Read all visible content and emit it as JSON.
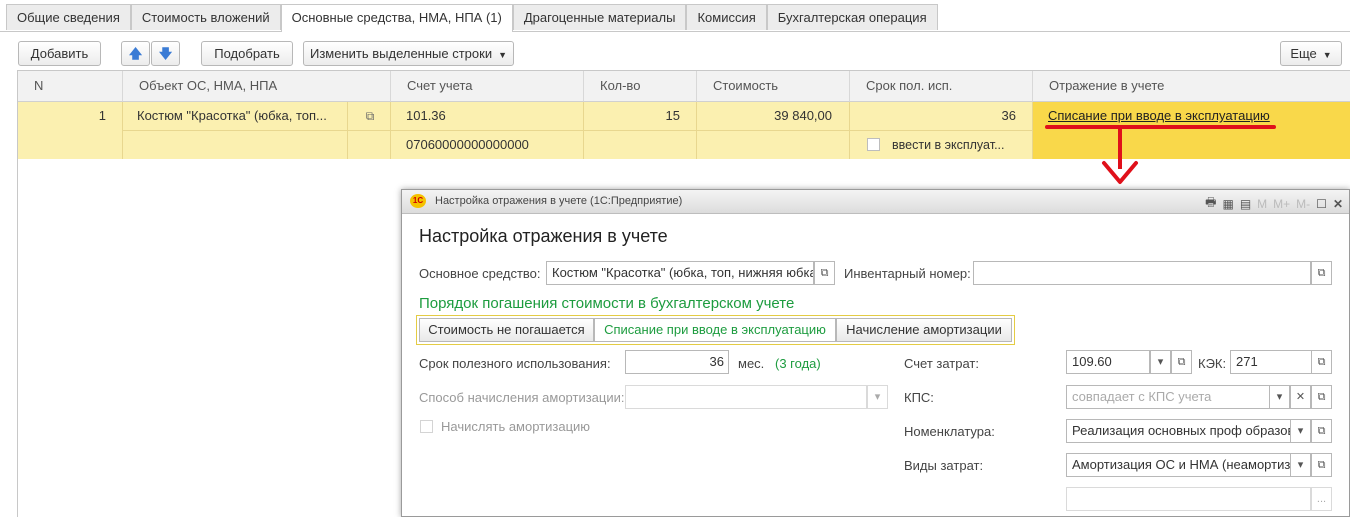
{
  "tabs": [
    "Общие сведения",
    "Стоимость вложений",
    "Основные средства, НМА, НПА (1)",
    "Драгоценные материалы",
    "Комиссия",
    "Бухгалтерская операция"
  ],
  "toolbar": {
    "add": "Добавить",
    "pick": "Подобрать",
    "edit_rows": "Изменить выделенные строки",
    "more": "Еще"
  },
  "table": {
    "headers": [
      "N",
      "Объект ОС, НМА, НПА",
      "Счет учета",
      "Кол-во",
      "Стоимость",
      "Срок пол. исп.",
      "Отражение в учете"
    ],
    "row": {
      "n": "1",
      "object": "Костюм \"Красотка\" (юбка, топ...",
      "account": "101.36",
      "account_code": "07060000000000000",
      "qty": "15",
      "cost": "39 840,00",
      "term": "36",
      "commission_label": "ввести в эксплуат...",
      "reflection": "Списание при вводе в эксплуатацию"
    }
  },
  "dialog": {
    "window_title": "Настройка отражения в учете  (1С:Предприятие)",
    "heading": "Настройка отражения в учете",
    "asset_label": "Основное средство:",
    "asset_value": "Костюм \"Красотка\" (юбка, топ, нижняя юбка",
    "inventory_label": "Инвентарный номер:",
    "inventory_value": "",
    "section_title": "Порядок погашения стоимости в бухгалтерском учете",
    "options": [
      "Стоимость не погашается",
      "Списание при вводе в эксплуатацию",
      "Начисление амортизации"
    ],
    "selected_option": 1,
    "life_label": "Срок полезного использования:",
    "life_value": "36",
    "life_unit": "мес.",
    "life_years": "(3 года)",
    "method_label": "Способ начисления амортизации:",
    "accrue_label": "Начислять амортизацию",
    "cost_account_label": "Счет затрат:",
    "cost_account_value": "109.60",
    "kek_label": "КЭК:",
    "kek_value": "271",
    "kps_label": "КПС:",
    "kps_placeholder": "совпадает с КПС учета",
    "nomenclature_label": "Номенклатура:",
    "nomenclature_value": "Реализация основных проф образов",
    "expense_label": "Виды затрат:",
    "expense_value": "Амортизация ОС и НМА (неамортизи"
  },
  "colors": {
    "row_highlight": "#fbf0b0",
    "active_cell": "#f9d84a",
    "annotation_red": "#e0101a",
    "section_green": "#1d9c3f"
  }
}
